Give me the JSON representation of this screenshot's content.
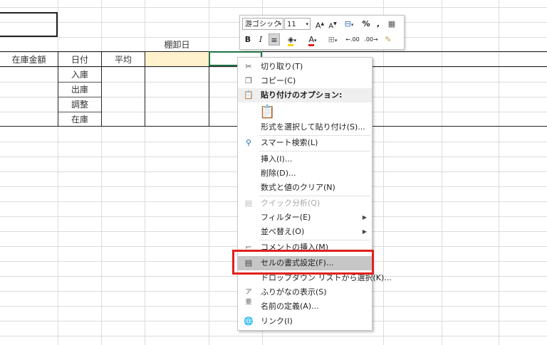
{
  "sheet": {
    "header_cells": [
      "在庫金額",
      "日付",
      "平均"
    ],
    "tanaoroshi_label": "棚卸日",
    "row_labels": [
      "入庫",
      "出庫",
      "調整",
      "在庫"
    ]
  },
  "mini_toolbar": {
    "font_name": "游ゴシック",
    "font_size": "11",
    "grow_font": "A",
    "shrink_font": "A",
    "percent": "%",
    "comma": ",",
    "bold": "B",
    "italic": "I",
    "font_color_letter": "A",
    "dec_increase": ".00",
    "dec_decrease": ".00"
  },
  "context_menu": {
    "cut": "切り取り(T)",
    "copy": "コピー(C)",
    "paste_options": "貼り付けのオプション:",
    "paste_special": "形式を選択して貼り付け(S)...",
    "smart_lookup": "スマート検索(L)",
    "insert": "挿入(I)...",
    "delete": "削除(D)...",
    "clear_contents": "数式と値のクリア(N)",
    "quick_analysis": "クイック分析(Q)",
    "filter": "フィルター(E)",
    "sort": "並べ替え(O)",
    "insert_comment": "コメントの挿入(M)",
    "format_cells": "セルの書式設定(F)...",
    "pick_from_list": "ドロップダウン リストから選択(K)...",
    "show_phonetic": "ふりがなの表示(S)",
    "define_name": "名前の定義(A)...",
    "link": "リンク(I)"
  },
  "colors": {
    "highlight_border": "#e0201c",
    "selected_cell_fill": "#fff2cc",
    "active_cell_border": "#217346",
    "hover_row": "#c6c6c6"
  }
}
